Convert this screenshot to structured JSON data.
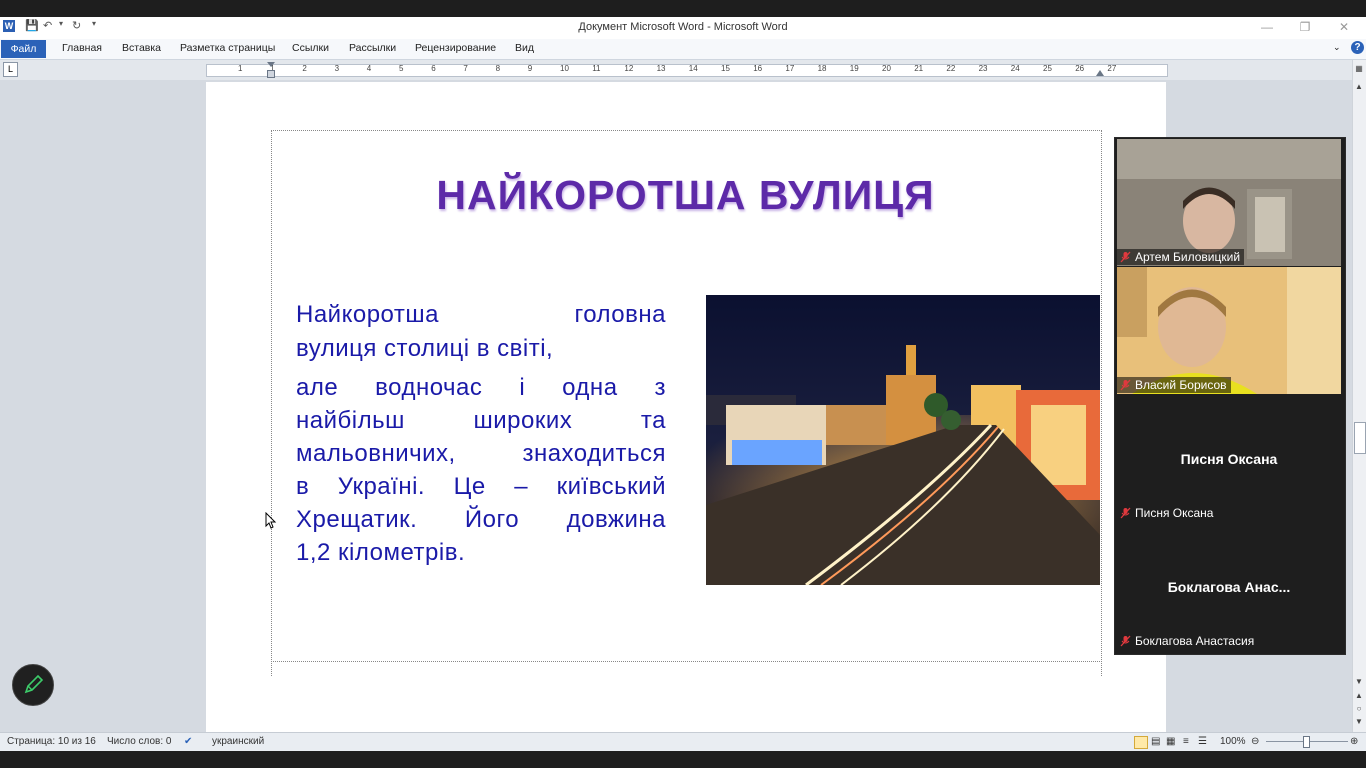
{
  "window": {
    "title": "Документ Microsoft Word  -  Microsoft Word"
  },
  "ribbon": {
    "file_tab": "Файл",
    "tabs": [
      "Главная",
      "Вставка",
      "Разметка страницы",
      "Ссылки",
      "Рассылки",
      "Рецензирование",
      "Вид"
    ]
  },
  "ruler": {
    "numbers": [
      "1",
      "1",
      "2",
      "3",
      "4",
      "5",
      "6",
      "7",
      "8",
      "9",
      "10",
      "11",
      "12",
      "13",
      "14",
      "15",
      "16",
      "17",
      "18",
      "19",
      "20",
      "21",
      "22",
      "23",
      "24",
      "25",
      "26",
      "27"
    ]
  },
  "slide": {
    "title": "НАЙКОРОТША ВУЛИЦЯ",
    "lines": [
      "Найкоротша головна",
      "вулиця столиці в світі,",
      "але водночас і одна з",
      "найбільш широких та",
      "мальовничих, знаходиться",
      "в Україні. Це – київський",
      "Хрещатик. Його довжина",
      "1,2 кілометрів."
    ]
  },
  "status": {
    "page": "Страница: 10 из 16",
    "words": "Число слов: 0",
    "language": "украинский",
    "zoom": "100%"
  },
  "video": {
    "participants": [
      {
        "label": "Артем Биловицкий"
      },
      {
        "label": "Власий Борисов"
      },
      {
        "display": "Писня Оксана",
        "label": "Писня Оксана"
      },
      {
        "display": "Боклагова  Анас...",
        "label": "Боклагова Анастасия"
      }
    ]
  },
  "colors": {
    "title_purple": "#5d2aa8",
    "body_blue": "#1a1aa8",
    "file_tab_blue": "#2b62b8",
    "muted_mic_red": "#e0393e"
  }
}
